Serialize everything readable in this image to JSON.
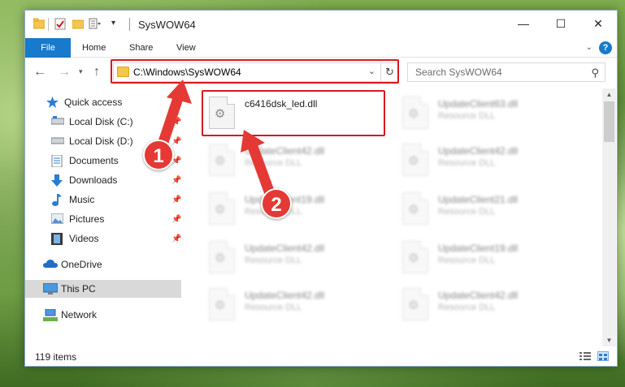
{
  "window": {
    "title": "SysWOW64",
    "controls": {
      "minimize": "—",
      "maximize": "☐",
      "close": "✕"
    }
  },
  "ribbon": {
    "tabs": [
      "File",
      "Home",
      "Share",
      "View"
    ],
    "help": "?"
  },
  "address": {
    "path": "C:\\Windows\\SysWOW64"
  },
  "search": {
    "placeholder": "Search SysWOW64"
  },
  "sidebar": {
    "items": [
      {
        "label": "Quick access",
        "icon": "star-icon"
      },
      {
        "label": "Local Disk (C:)",
        "icon": "drive-icon",
        "pinned": true
      },
      {
        "label": "Local Disk (D:)",
        "icon": "drive-icon",
        "pinned": true
      },
      {
        "label": "Documents",
        "icon": "documents-icon",
        "pinned": true
      },
      {
        "label": "Downloads",
        "icon": "download-icon",
        "pinned": true
      },
      {
        "label": "Music",
        "icon": "music-icon",
        "pinned": true
      },
      {
        "label": "Pictures",
        "icon": "pictures-icon",
        "pinned": true
      },
      {
        "label": "Videos",
        "icon": "videos-icon",
        "pinned": true
      },
      {
        "label": "OneDrive",
        "icon": "cloud-icon"
      },
      {
        "label": "This PC",
        "icon": "monitor-icon",
        "selected": true
      },
      {
        "label": "Network",
        "icon": "network-icon"
      }
    ]
  },
  "files": [
    {
      "name": "c6416dsk_led.dll",
      "type": "",
      "highlighted": true
    },
    {
      "name": "UpdateClient63.dll",
      "type": "Resource DLL"
    },
    {
      "name": "UpdateClient42.dll",
      "type": "Resource DLL"
    },
    {
      "name": "UpdateClient42.dll",
      "type": "Resource DLL"
    },
    {
      "name": "UpdateClient19.dll",
      "type": "Resource DLL"
    },
    {
      "name": "UpdateClient21.dll",
      "type": "Resource DLL"
    },
    {
      "name": "UpdateClient42.dll",
      "type": "Resource DLL"
    },
    {
      "name": "UpdateClient19.dll",
      "type": "Resource DLL"
    },
    {
      "name": "UpdateClient42.dll",
      "type": "Resource DLL"
    },
    {
      "name": "UpdateClient42.dll",
      "type": "Resource DLL"
    }
  ],
  "status": {
    "item_count": "119 items"
  },
  "annotations": {
    "step1": "1",
    "step2": "2"
  },
  "colors": {
    "accent": "#1979ca",
    "annotation": "#e53935",
    "selection": "#d9d9d9"
  }
}
